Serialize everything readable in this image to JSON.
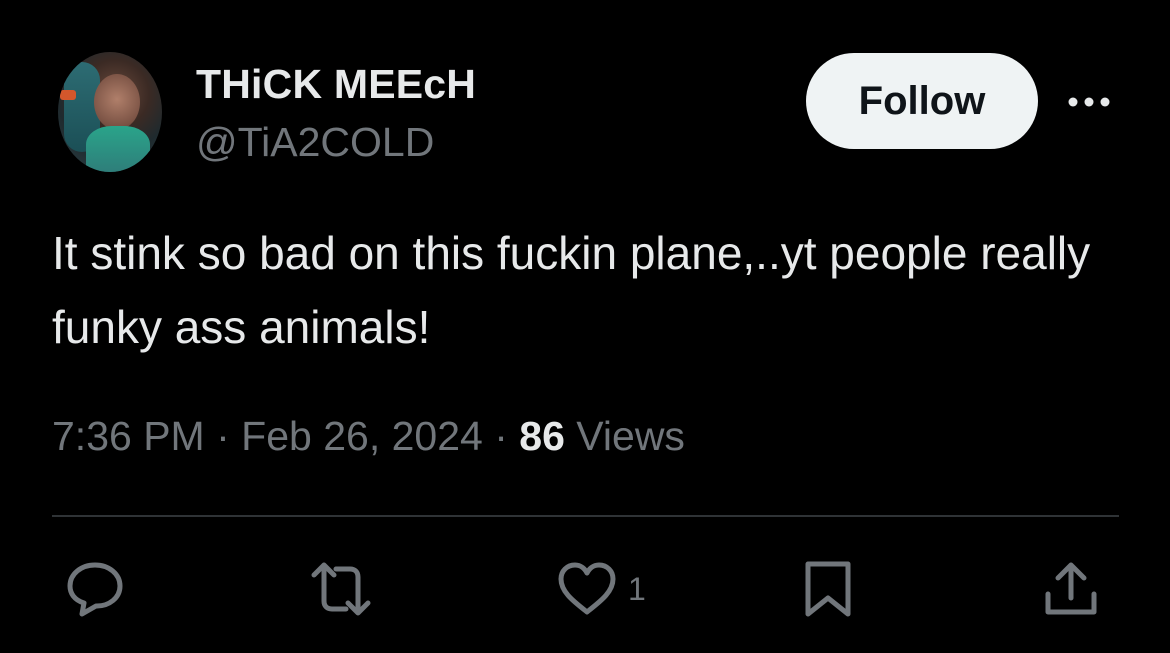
{
  "author": {
    "display_name": "THiCK MEEcH",
    "handle": "@TiA2COLD"
  },
  "header": {
    "follow_label": "Follow"
  },
  "tweet": {
    "text": "It stink so bad on this fuckin plane,..yt people really funky ass animals!",
    "time": "7:36 PM",
    "separator": "·",
    "date": "Feb 26, 2024",
    "views_count": "86",
    "views_label": "Views"
  },
  "actions": {
    "likes_count": "1"
  },
  "icons": [
    "reply-icon",
    "retweet-icon",
    "heart-icon",
    "bookmark-icon",
    "share-icon",
    "more-icon"
  ],
  "colors": {
    "background": "#000000",
    "primary_text": "#e7e9ea",
    "secondary_text": "#71767b",
    "follow_button_bg": "#eff3f4",
    "divider": "#2f3336"
  }
}
